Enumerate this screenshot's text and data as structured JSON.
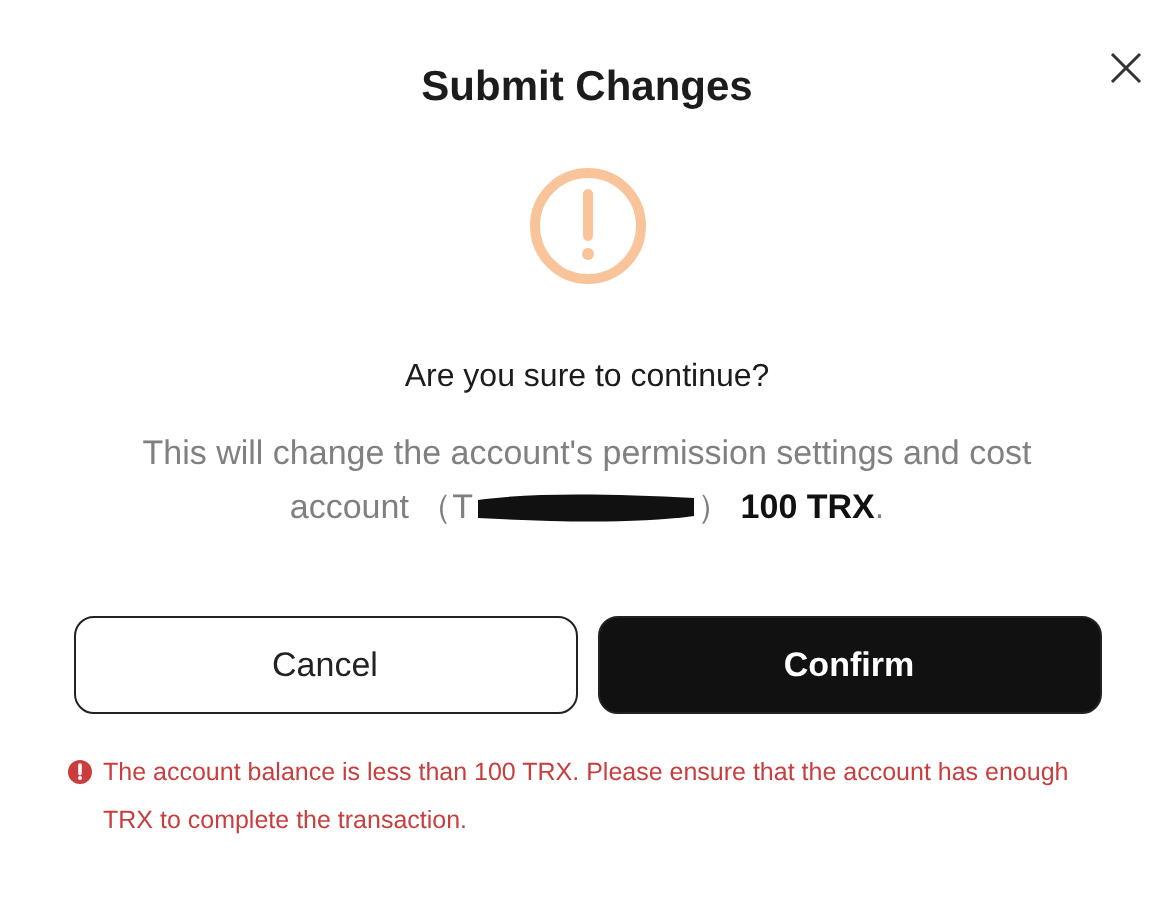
{
  "dialog": {
    "title": "Submit Changes",
    "question": "Are you sure to continue?",
    "description_line": "This will change the account's permission settings and cost",
    "description_before": "account （T",
    "description_after": "） **100 TRX**.",
    "buttons": [
      {
        "label": "Cancel",
        "kind": "secondary"
      },
      {
        "label": "Confirm",
        "kind": "primary"
      }
    ],
    "error": "The account balance is less than 100 TRX. Please ensure that the account has enough TRX to complete the transaction."
  }
}
